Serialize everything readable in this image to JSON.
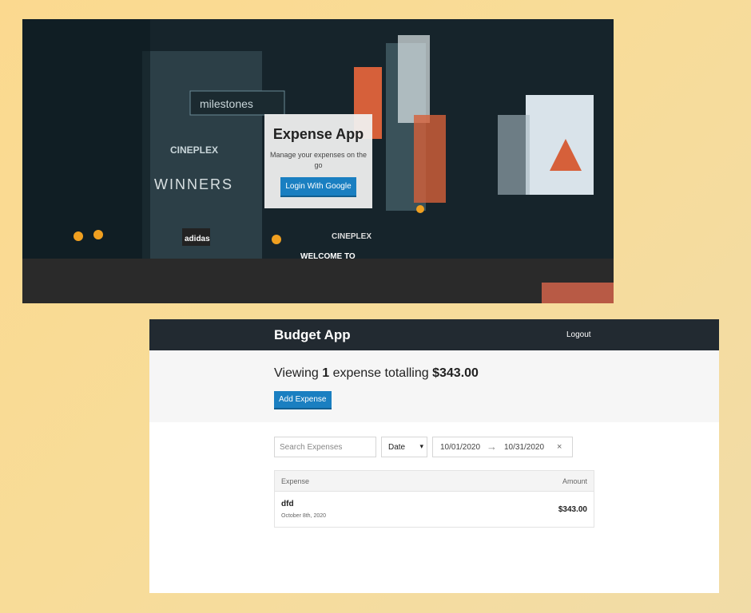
{
  "login": {
    "title": "Expense App",
    "subtitle": "Manage your expenses on the go",
    "button_label": "Login With Google",
    "background_signs": [
      "milestones",
      "CINEPLEX",
      "WINNERS",
      "adidas",
      "WELCOME TO",
      "CINEPLEX"
    ]
  },
  "app": {
    "title": "Budget App",
    "logout_label": "Logout",
    "summary": {
      "prefix": "Viewing",
      "count": "1",
      "middle": "expense totalling",
      "total": "$343.00"
    },
    "add_button_label": "Add Expense",
    "filters": {
      "search_placeholder": "Search Expenses",
      "sort_value": "Date",
      "start_date": "10/01/2020",
      "end_date": "10/31/2020",
      "clear_glyph": "×",
      "arrow_glyph": "→"
    },
    "table": {
      "headers": {
        "expense": "Expense",
        "amount": "Amount"
      },
      "rows": [
        {
          "name": "dfd",
          "date": "October 8th, 2020",
          "amount": "$343.00"
        }
      ]
    },
    "colors": {
      "header_bg": "#222a31",
      "accent": "#1a7fc1",
      "summary_bg": "#f6f6f6"
    }
  }
}
